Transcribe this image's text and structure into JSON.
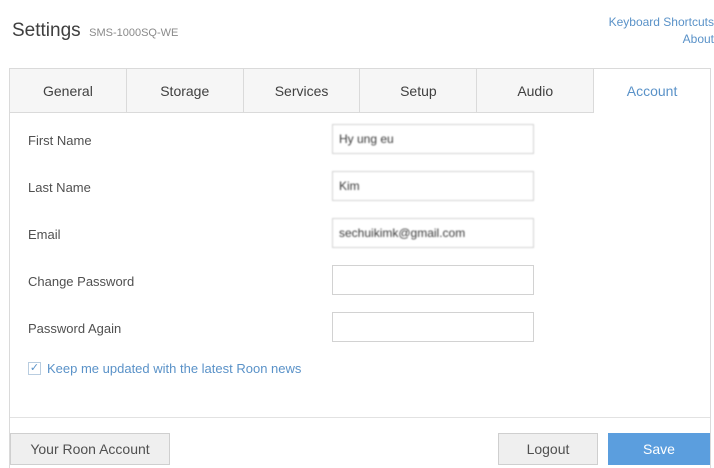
{
  "header": {
    "title": "Settings",
    "device_name": "SMS-1000SQ-WE"
  },
  "top_links": {
    "keyboard_shortcuts": "Keyboard Shortcuts",
    "about": "About"
  },
  "tabs": [
    {
      "label": "General"
    },
    {
      "label": "Storage"
    },
    {
      "label": "Services"
    },
    {
      "label": "Setup"
    },
    {
      "label": "Audio"
    },
    {
      "label": "Account",
      "active": true
    }
  ],
  "form": {
    "first_name": {
      "label": "First Name",
      "value": "Hy ung eu"
    },
    "last_name": {
      "label": "Last Name",
      "value": "Kim"
    },
    "email": {
      "label": "Email",
      "value": "sechuikimk@gmail.com"
    },
    "change_password": {
      "label": "Change Password",
      "value": ""
    },
    "password_again": {
      "label": "Password Again",
      "value": ""
    }
  },
  "newsletter": {
    "label": "Keep me updated with the latest Roon news",
    "checked": true,
    "check_glyph": "✓"
  },
  "buttons": {
    "your_account": "Your Roon Account",
    "logout": "Logout",
    "save": "Save"
  },
  "colors": {
    "accent": "#5a92c8",
    "save_bg": "#5b9ede",
    "tab_bg": "#f6f6f6",
    "border": "#dadada"
  }
}
